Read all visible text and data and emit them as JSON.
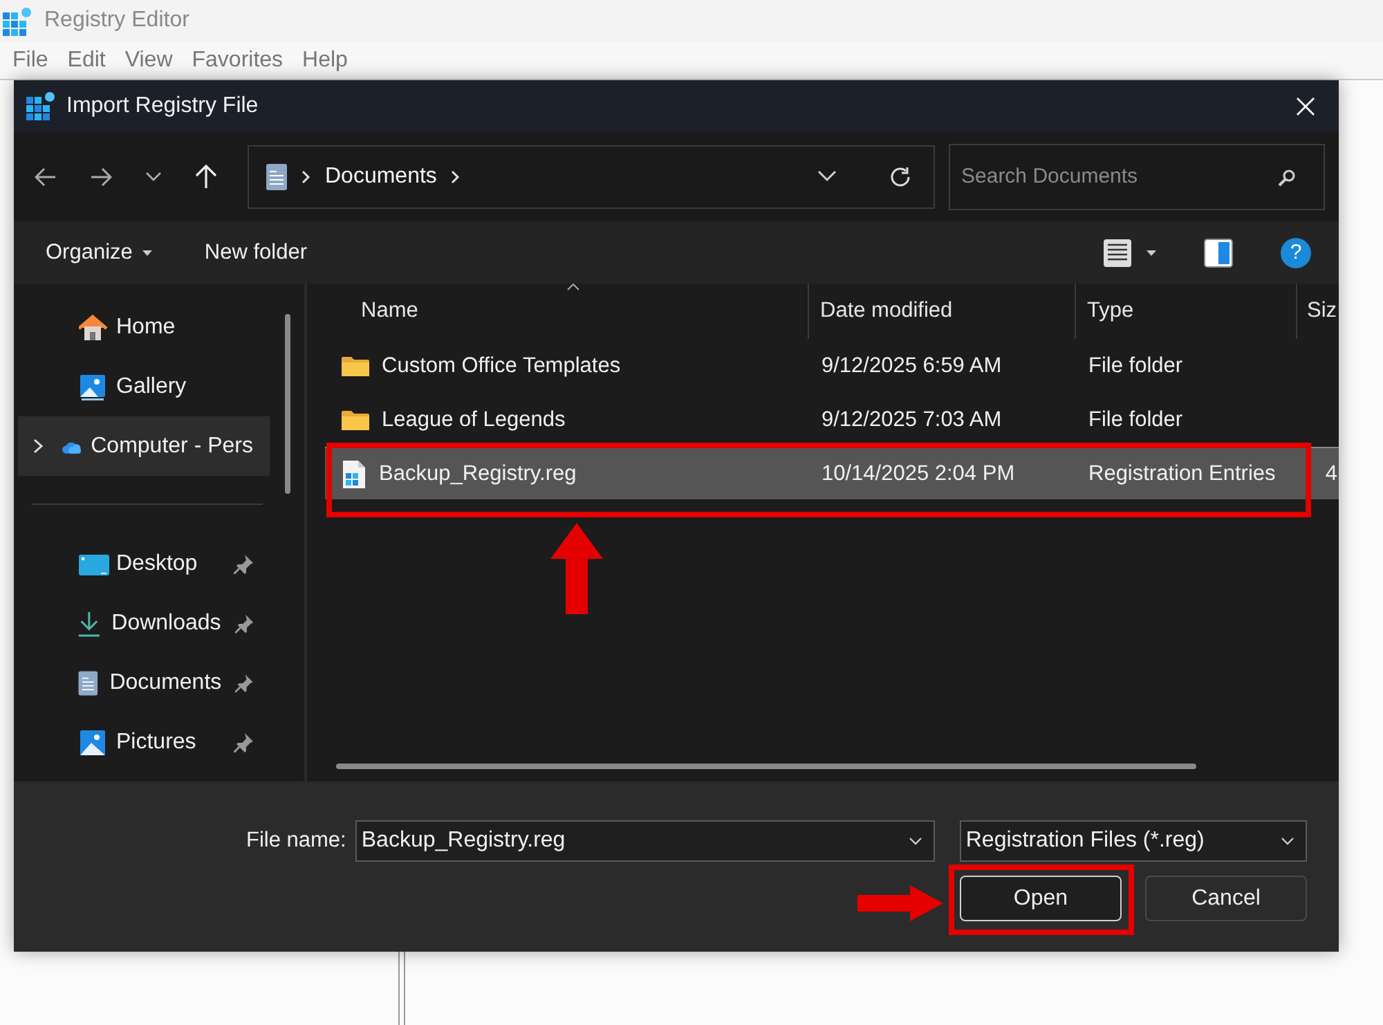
{
  "app": {
    "title": "Registry Editor",
    "menu": [
      "File",
      "Edit",
      "View",
      "Favorites",
      "Help"
    ]
  },
  "dialog": {
    "title": "Import Registry File",
    "breadcrumb": [
      "Documents"
    ],
    "search": {
      "placeholder": "Search Documents"
    },
    "toolbar": [
      "Organize",
      "New folder"
    ],
    "help_button": "?",
    "sidebar": {
      "top_items": [
        {
          "label": "Home",
          "kind": "home",
          "expandable": false,
          "selected": false
        },
        {
          "label": "Gallery",
          "kind": "gallery",
          "expandable": false,
          "selected": false
        },
        {
          "label": "Computer - Pers",
          "kind": "cloud",
          "expandable": true,
          "selected": true
        }
      ],
      "pinned_items": [
        {
          "label": "Desktop",
          "kind": "desktop",
          "pinned": true
        },
        {
          "label": "Downloads",
          "kind": "download",
          "pinned": true
        },
        {
          "label": "Documents",
          "kind": "document",
          "pinned": true
        },
        {
          "label": "Pictures",
          "kind": "picture",
          "pinned": true
        }
      ]
    },
    "table": {
      "columns": [
        {
          "label": "Name",
          "sorted": true
        },
        {
          "label": "Date modified",
          "sorted": false
        },
        {
          "label": "Type",
          "sorted": false
        },
        {
          "label": "Siz",
          "sorted": false
        }
      ],
      "rows": [
        {
          "kind": "folder",
          "name": "Custom Office Templates",
          "date": "9/12/2025 6:59 AM",
          "type": "File folder",
          "selected": false
        },
        {
          "kind": "folder",
          "name": "League of Legends",
          "date": "9/12/2025 7:03 AM",
          "type": "File folder",
          "selected": false
        },
        {
          "kind": "reg",
          "name": "Backup_Registry.reg",
          "date": "10/14/2025 2:04 PM",
          "type": "Registration Entries",
          "size": "4",
          "selected": true
        }
      ]
    },
    "file_name": {
      "label": "File name:",
      "value": "Backup_Registry.reg"
    },
    "file_type": {
      "value": "Registration Files (*.reg)"
    },
    "buttons": [
      {
        "label": "Open",
        "kind": "primary"
      },
      {
        "label": "Cancel",
        "kind": "secondary"
      }
    ]
  }
}
